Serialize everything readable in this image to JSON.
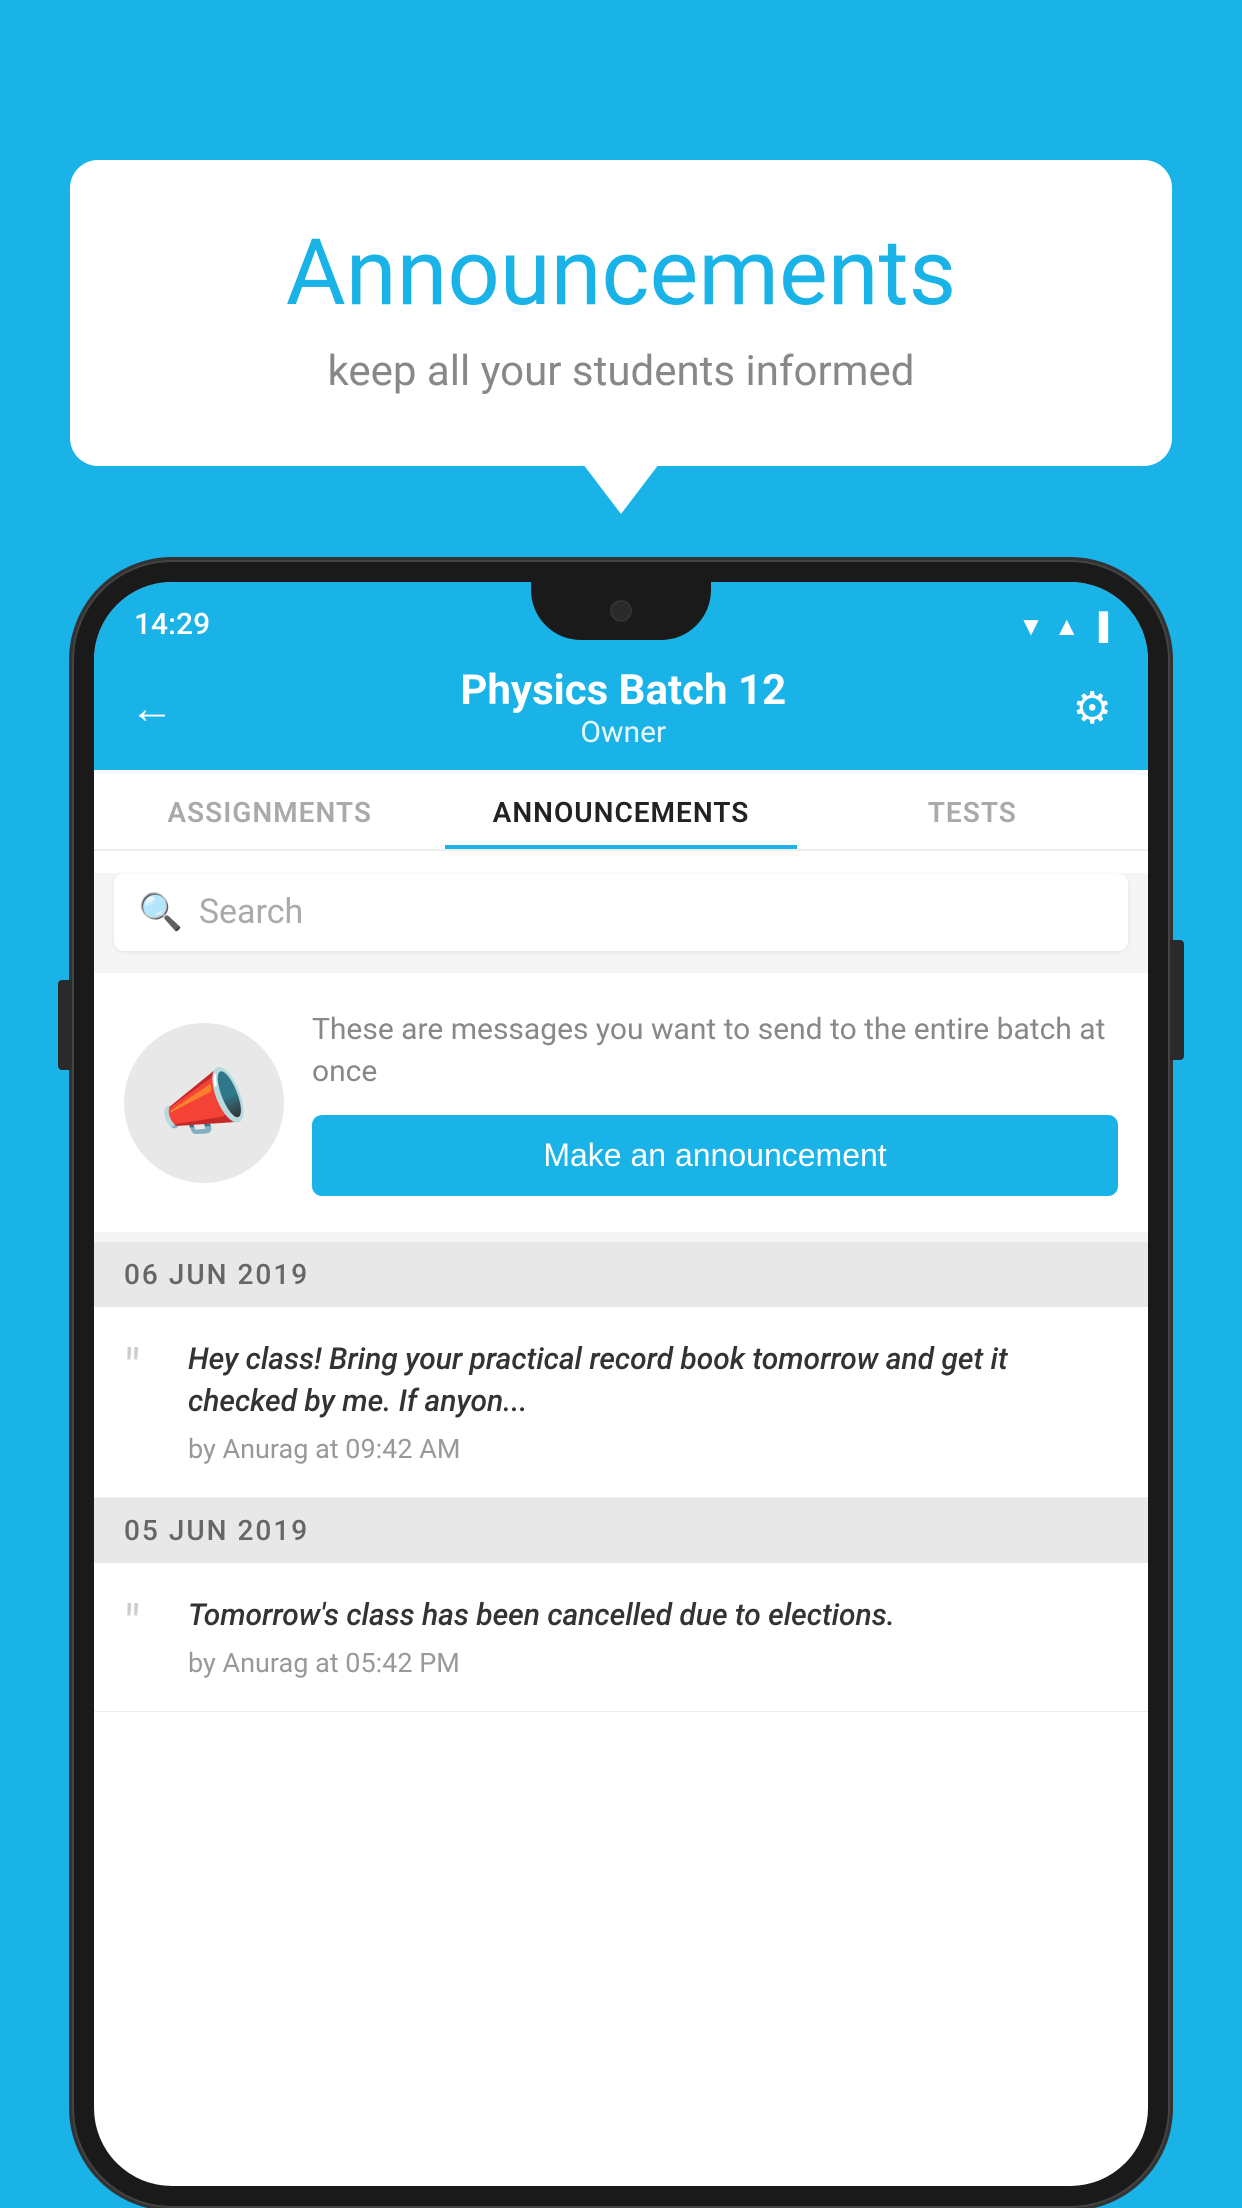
{
  "background_color": "#1ab3e8",
  "bubble": {
    "title": "Announcements",
    "subtitle": "keep all your students informed"
  },
  "status_bar": {
    "time": "14:29",
    "icons": [
      "wifi",
      "signal",
      "battery"
    ]
  },
  "header": {
    "title": "Physics Batch 12",
    "subtitle": "Owner",
    "back_label": "←",
    "gear_label": "⚙"
  },
  "tabs": [
    {
      "label": "ASSIGNMENTS",
      "active": false
    },
    {
      "label": "ANNOUNCEMENTS",
      "active": true
    },
    {
      "label": "TESTS",
      "active": false
    }
  ],
  "search": {
    "placeholder": "Search"
  },
  "promo": {
    "description": "These are messages you want to send to the entire batch at once",
    "button_label": "Make an announcement"
  },
  "date_groups": [
    {
      "date": "06  JUN  2019",
      "announcements": [
        {
          "text": "Hey class! Bring your practical record book tomorrow and get it checked by me. If anyon...",
          "meta": "by Anurag at 09:42 AM"
        }
      ]
    },
    {
      "date": "05  JUN  2019",
      "announcements": [
        {
          "text": "Tomorrow's class has been cancelled due to elections.",
          "meta": "by Anurag at 05:42 PM"
        }
      ]
    }
  ]
}
